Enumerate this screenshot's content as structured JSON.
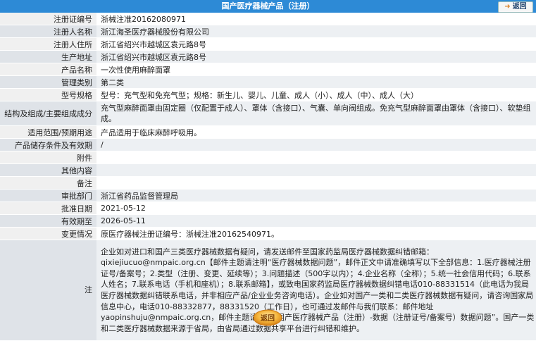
{
  "header": {
    "title": "国产医疗器械产品（注册）",
    "back_label": "返回"
  },
  "fields": [
    {
      "label": "注册证编号",
      "value": "浙械注准20162080971"
    },
    {
      "label": "注册人名称",
      "value": "浙江海圣医疗器械股份有限公司"
    },
    {
      "label": "注册人住所",
      "value": "浙江省绍兴市越城区袁元路8号"
    },
    {
      "label": "生产地址",
      "value": "浙江省绍兴市越城区袁元路8号"
    },
    {
      "label": "产品名称",
      "value": "一次性使用麻醉面罩"
    },
    {
      "label": "管理类别",
      "value": "第二类"
    },
    {
      "label": "型号规格",
      "value": "型号：充气型和免充气型；规格：新生儿、婴儿、儿童、成人（小）、成人（中）、成人（大）"
    },
    {
      "label": "结构及组成/主要组成成分",
      "value": "充气型麻醉面罩由固定圈（仅配置于成人）、罩体（含接口）、气囊、单向阀组成。免充气型麻醉面罩由罩体（含接口）、软垫组成。"
    },
    {
      "label": "适用范围/预期用途",
      "value": "产品适用于临床麻醉呼吸用。"
    },
    {
      "label": "产品储存条件及有效期",
      "value": "/"
    },
    {
      "label": "附件",
      "value": ""
    },
    {
      "label": "其他内容",
      "value": ""
    },
    {
      "label": "备注",
      "value": ""
    },
    {
      "label": "审批部门",
      "value": "浙江省药品监督管理局"
    },
    {
      "label": "批准日期",
      "value": "2021-05-12"
    },
    {
      "label": "有效期至",
      "value": "2026-05-11"
    },
    {
      "label": "变更情况",
      "value": "原医疗器械注册证编号：浙械注准20162540971。"
    },
    {
      "label": "注",
      "value": "企业如对进口和国产三类医疗器械数据有疑问，请发送邮件至国家药监局医疗器械数据纠错邮箱：qixiejiucuo@nmpaic.org.cn【邮件主题请注明“医疗器械数据问题”，邮件正文中请准确填写以下全部信息：1.医疗器械注册证号/备案号；2.类型（注册、变更、延续等）；3.问题描述（500字以内）；4.企业名称（全称）；5.统一社会信用代码；6.联系人姓名；7.联系电话（手机和座机）；8.联系邮箱】，或致电国家药监局医疗器械数据纠错电话010-88331514（此电话为我局医疗器械数据纠错联系电话，并非相应产品/企业业务咨询电话）。企业如对国产一类和二类医疗器械数据有疑问，请咨询国家局信息中心，电话010-88332877，88331520（工作日），也可通过发邮件与我们联系：邮件地址yaopinshuju@nmpaic.org.cn，邮件主题请注明“国产医疗器械产品（注册）-数据（注册证号/备案号）数据问题”。国产一类和二类医疗器械数据来源于省局，由省局通过数据共享平台进行纠错和维护。"
    }
  ],
  "footer": {
    "back_label": "返回"
  },
  "colors": {
    "header_bg": "#2d8ad6",
    "label_bg": "#f0f0f0",
    "band_label_bg": "#dfe3e8",
    "band_value_bg": "#edf0f3"
  }
}
